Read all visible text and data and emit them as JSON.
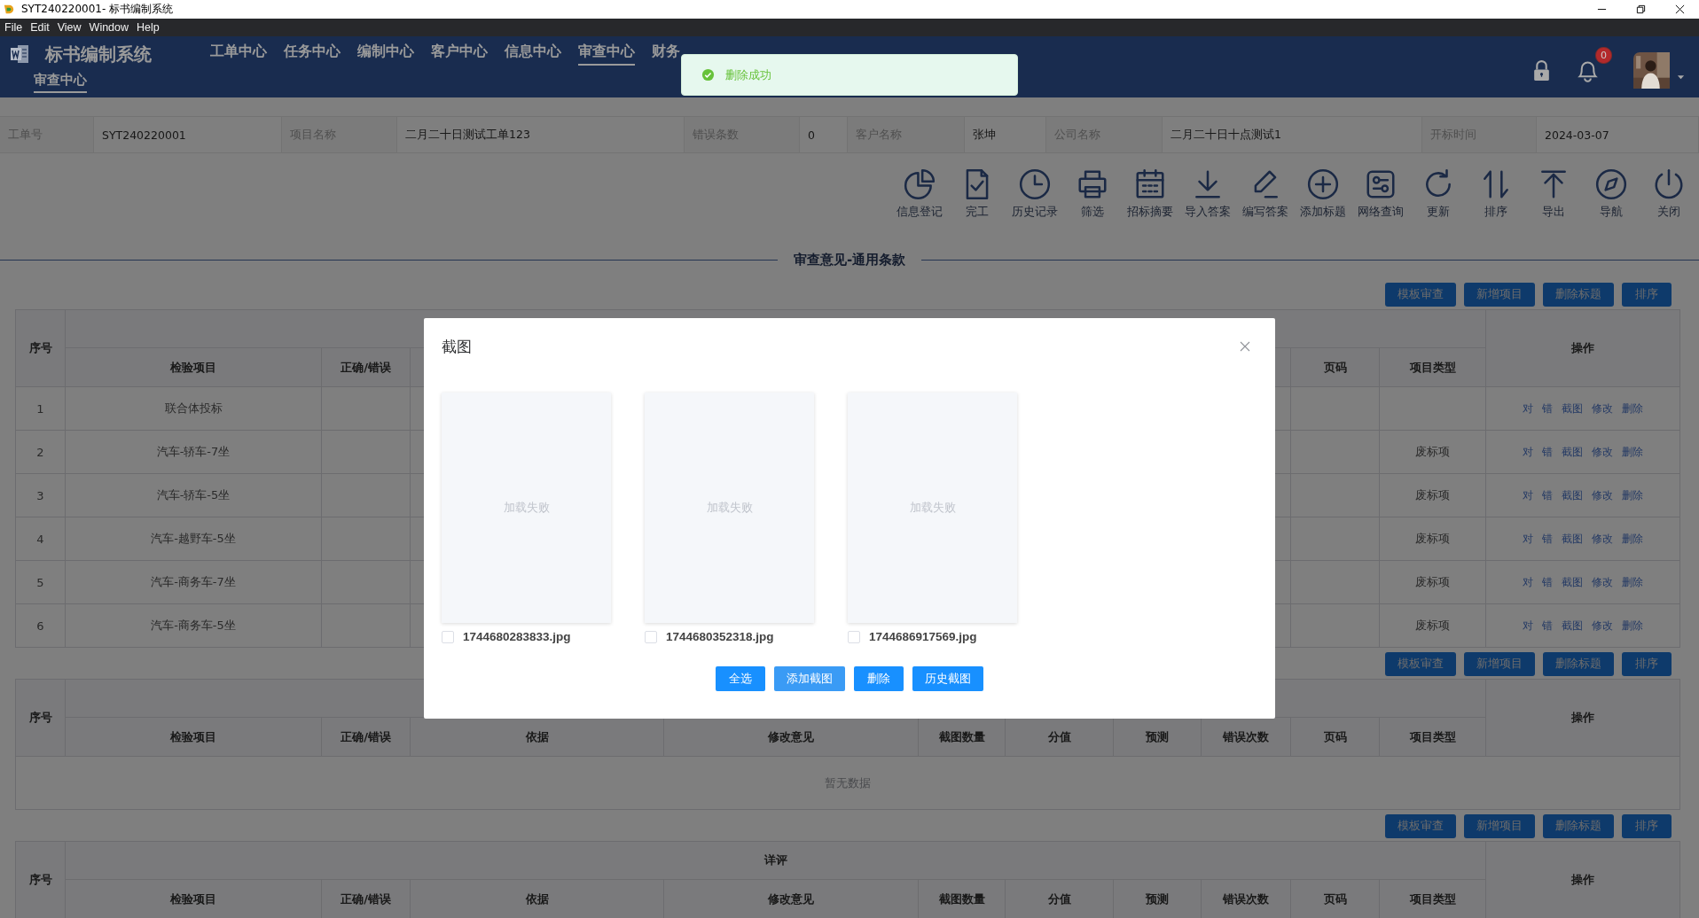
{
  "window": {
    "title": "SYT240220001- 标书编制系统"
  },
  "menu": [
    "File",
    "Edit",
    "View",
    "Window",
    "Help"
  ],
  "header": {
    "app_name": "标书编制系统",
    "nav": [
      {
        "label": "工单中心",
        "selected": false
      },
      {
        "label": "任务中心",
        "selected": false
      },
      {
        "label": "编制中心",
        "selected": false
      },
      {
        "label": "客户中心",
        "selected": false
      },
      {
        "label": "信息中心",
        "selected": false
      },
      {
        "label": "审查中心",
        "selected": true
      },
      {
        "label": "财务",
        "selected": false
      }
    ],
    "sub_nav": [
      {
        "label": "审查中心",
        "selected": true
      }
    ],
    "notification_count": "0"
  },
  "toast": {
    "kind": "success",
    "message": "删除成功"
  },
  "info": [
    {
      "label": "工单号",
      "value": "SYT240220001"
    },
    {
      "label": "项目名称",
      "value": "二月二十日测试工单123"
    },
    {
      "label": "错误条数",
      "value": "0"
    },
    {
      "label": "客户名称",
      "value": "张坤"
    },
    {
      "label": "公司名称",
      "value": "二月二十日十点测试1"
    },
    {
      "label": "开标时间",
      "value": "2024-03-07"
    }
  ],
  "toolbar": [
    "信息登记",
    "完工",
    "历史记录",
    "筛选",
    "招标摘要",
    "导入答案",
    "编写答案",
    "添加标题",
    "网络查询",
    "更新",
    "排序",
    "导出",
    "导航",
    "关闭"
  ],
  "section_title": "审查意见-通用条款",
  "sections": [
    {
      "buttons": [
        "模板审查",
        "新增项目",
        "删除标题",
        "排序"
      ],
      "table": {
        "columns": [
          "序号",
          "检验项目",
          "正确/错误",
          null,
          null,
          null,
          null,
          null,
          null,
          "页码",
          "项目类型",
          "操作"
        ],
        "rows": [
          {
            "index": "1",
            "item": "联合体投标",
            "actions": [
              "对",
              "错",
              "截图",
              "修改",
              "删除"
            ]
          },
          {
            "index": "2",
            "item": "汽车-轿车-7坐",
            "type": "废标项",
            "actions": [
              "对",
              "错",
              "截图",
              "修改",
              "删除"
            ]
          },
          {
            "index": "3",
            "item": "汽车-轿车-5坐",
            "type": "废标项",
            "actions": [
              "对",
              "错",
              "截图",
              "修改",
              "删除"
            ]
          },
          {
            "index": "4",
            "item": "汽车-越野车-5坐",
            "type": "废标项",
            "actions": [
              "对",
              "错",
              "截图",
              "修改",
              "删除"
            ]
          },
          {
            "index": "5",
            "item": "汽车-商务车-7坐",
            "type": "废标项",
            "actions": [
              "对",
              "错",
              "截图",
              "修改",
              "删除"
            ]
          },
          {
            "index": "6",
            "item": "汽车-商务车-5坐",
            "type": "废标项",
            "actions": [
              "对",
              "错",
              "截图",
              "修改",
              "删除"
            ]
          }
        ]
      }
    },
    {
      "buttons": [
        "模板审查",
        "新增项目",
        "删除标题",
        "排序"
      ],
      "table": {
        "columns": [
          "序号",
          "检验项目",
          "正确/错误",
          "依据",
          "修改意见",
          "截图数量",
          "分值",
          "预测",
          "错误次数",
          "页码",
          "项目类型",
          "操作"
        ],
        "empty_text": "暂无数据"
      }
    },
    {
      "buttons": [
        "模板审查",
        "新增项目",
        "删除标题",
        "排序"
      ],
      "table": {
        "group_title": "详评",
        "columns": [
          "序号",
          "检验项目",
          "正确/错误",
          "依据",
          "修改意见",
          "截图数量",
          "分值",
          "预测",
          "错误次数",
          "页码",
          "项目类型",
          "操作"
        ]
      }
    }
  ],
  "dialog": {
    "title": "截图",
    "images": [
      {
        "status": "加载失败",
        "filename": "1744680283833.jpg",
        "checked": false
      },
      {
        "status": "加载失败",
        "filename": "1744680352318.jpg",
        "checked": false
      },
      {
        "status": "加载失败",
        "filename": "1744686917569.jpg",
        "checked": false
      }
    ],
    "buttons": [
      {
        "label": "全选",
        "kind": "primary"
      },
      {
        "label": "添加截图",
        "kind": "light"
      },
      {
        "label": "删除",
        "kind": "primary"
      },
      {
        "label": "历史截图",
        "kind": "primary"
      }
    ]
  }
}
